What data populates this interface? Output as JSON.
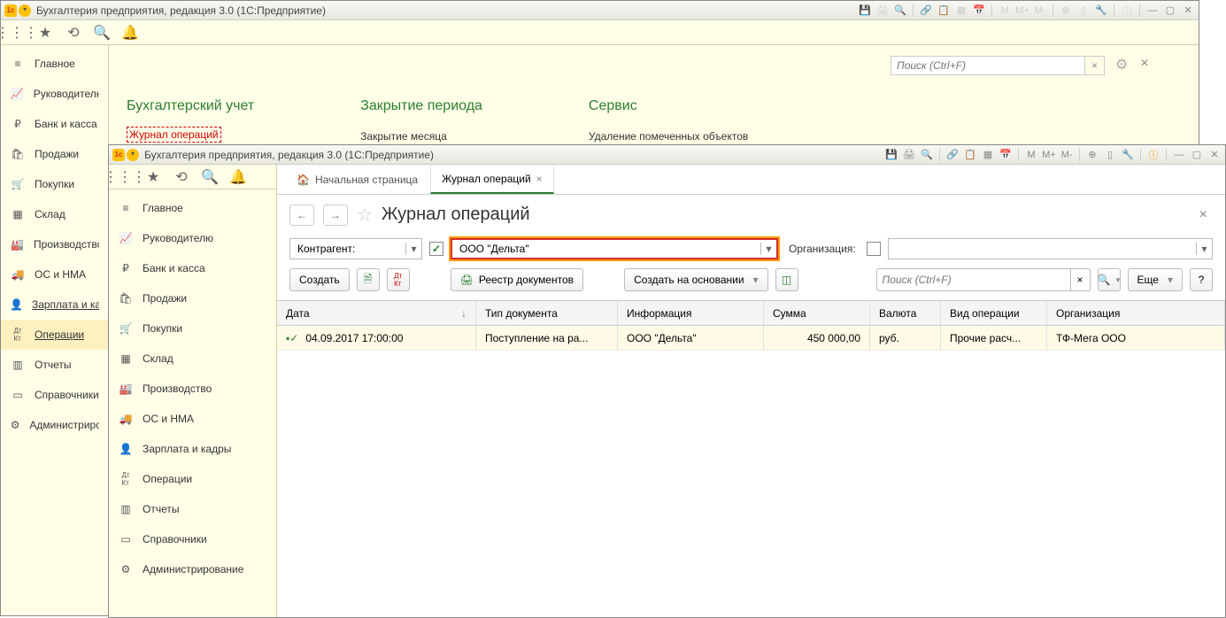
{
  "app": {
    "title": "Бухгалтерия предприятия, редакция 3.0  (1С:Предприятие)"
  },
  "subbar_icons": [
    "⋮⋮⋮",
    "★",
    "⟲",
    "🔍",
    "🔔"
  ],
  "search": {
    "placeholder": "Поиск (Ctrl+F)",
    "clear": "×"
  },
  "sidebar1": {
    "items": [
      {
        "icon": "≡",
        "label": "Главное"
      },
      {
        "icon": "📈",
        "label": "Руководителю"
      },
      {
        "icon": "₽",
        "label": "Банк и касса"
      },
      {
        "icon": "🛍",
        "label": "Продажи"
      },
      {
        "icon": "🛒",
        "label": "Покупки"
      },
      {
        "icon": "▦",
        "label": "Склад"
      },
      {
        "icon": "🏭",
        "label": "Производство"
      },
      {
        "icon": "🚚",
        "label": "ОС и НМА"
      },
      {
        "icon": "👤",
        "label": "Зарплата и кадры",
        "underline": true
      },
      {
        "icon": "ᴬᴷ",
        "label": "Операции",
        "active": true
      },
      {
        "icon": "▥",
        "label": "Отчеты"
      },
      {
        "icon": "▭",
        "label": "Справочники"
      },
      {
        "icon": "⚙",
        "label": "Администрирование"
      }
    ]
  },
  "sections": {
    "s1": {
      "title": "Бухгалтерский учет",
      "link": "Журнал операций"
    },
    "s2": {
      "title": "Закрытие периода",
      "link": "Закрытие месяца"
    },
    "s3": {
      "title": "Сервис",
      "link": "Удаление помеченных объектов"
    }
  },
  "sidebar2": {
    "items": [
      {
        "icon": "≡",
        "label": "Главное"
      },
      {
        "icon": "📈",
        "label": "Руководителю"
      },
      {
        "icon": "₽",
        "label": "Банк и касса"
      },
      {
        "icon": "🛍",
        "label": "Продажи"
      },
      {
        "icon": "🛒",
        "label": "Покупки"
      },
      {
        "icon": "▦",
        "label": "Склад"
      },
      {
        "icon": "🏭",
        "label": "Производство"
      },
      {
        "icon": "🚚",
        "label": "ОС и НМА"
      },
      {
        "icon": "👤",
        "label": "Зарплата и кадры"
      },
      {
        "icon": "ᴬᴷ",
        "label": "Операции"
      },
      {
        "icon": "▥",
        "label": "Отчеты"
      },
      {
        "icon": "▭",
        "label": "Справочники"
      },
      {
        "icon": "⚙",
        "label": "Администрирование"
      }
    ]
  },
  "tabs": {
    "home": "Начальная страница",
    "active": "Журнал операций"
  },
  "page": {
    "title": "Журнал операций"
  },
  "filter": {
    "field_label": "Контрагент:",
    "value": "ООО \"Дельта\"",
    "org_label": "Организация:"
  },
  "toolbar": {
    "create": "Создать",
    "registry": "Реестр документов",
    "create_based": "Создать на основании",
    "more": "Еще",
    "help": "?"
  },
  "grid": {
    "headers": [
      "Дата",
      "Тип документа",
      "Информация",
      "Сумма",
      "Валюта",
      "Вид операции",
      "Организация"
    ],
    "row": {
      "date": "04.09.2017 17:00:00",
      "doctype": "Поступление на ра...",
      "info": "ООО \"Дельта\"",
      "sum": "450 000,00",
      "currency": "руб.",
      "optype": "Прочие расч...",
      "org": "ТФ-Мега ООО"
    }
  },
  "titlebar_icons": {
    "m": "M",
    "mplus": "M+",
    "mminus": "M-"
  }
}
